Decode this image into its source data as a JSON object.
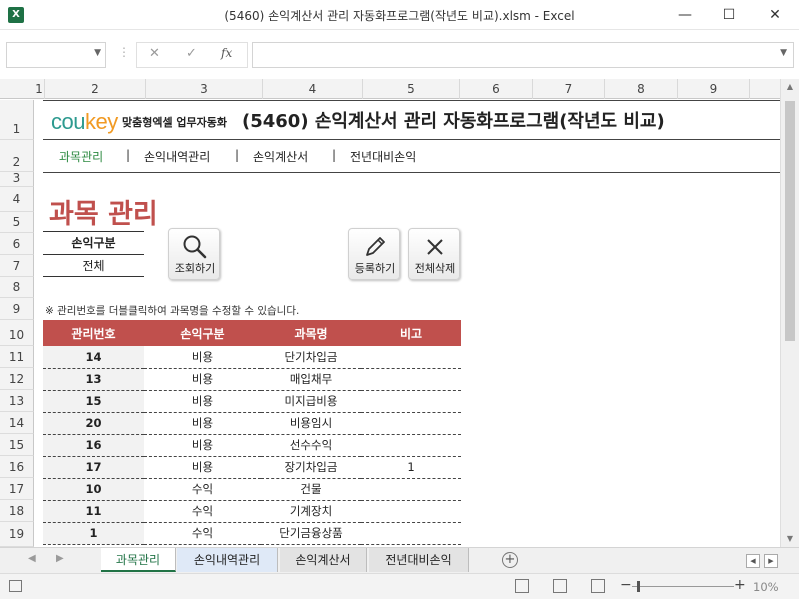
{
  "window": {
    "title": "(5460) 손익계산서 관리 자동화프로그램(작년도 비교).xlsm - Excel",
    "app_icon": "X",
    "minimize": "—",
    "maximize": "☐",
    "close": "✕"
  },
  "formula_bar": {
    "cancel": "✕",
    "enter": "✓",
    "fx": "fx",
    "sep": "⋮"
  },
  "columns": [
    "1",
    "2",
    "3",
    "4",
    "5",
    "6",
    "7",
    "8",
    "9"
  ],
  "rows": [
    "1",
    "2",
    "3",
    "4",
    "5",
    "6",
    "7",
    "8",
    "9",
    "10",
    "11",
    "12",
    "13",
    "14",
    "15",
    "16",
    "17",
    "18",
    "19"
  ],
  "header": {
    "logo_main": "cou",
    "logo_accent": "key",
    "logo_sub": "맞춤형엑셀 업무자동화",
    "title": "(5460) 손익계산서 관리 자동화프로그램(작년도 비교)"
  },
  "nav": {
    "items": [
      "과목관리",
      "손익내역관리",
      "손익계산서",
      "전년대비손익"
    ],
    "sep": "|"
  },
  "section_title": "과목 관리",
  "filter": {
    "label": "손익구분",
    "value": "전체"
  },
  "buttons": {
    "search": "조회하기",
    "register": "등록하기",
    "delete_all": "전체삭제"
  },
  "note": "※ 관리번호를 더블클릭하여 과목명을 수정할 수 있습니다.",
  "table": {
    "headers": [
      "관리번호",
      "손익구분",
      "과목명",
      "비고"
    ],
    "rows": [
      [
        "14",
        "비용",
        "단기차입금",
        ""
      ],
      [
        "13",
        "비용",
        "매입채무",
        ""
      ],
      [
        "15",
        "비용",
        "미지급비용",
        ""
      ],
      [
        "20",
        "비용",
        "비용임시",
        ""
      ],
      [
        "16",
        "비용",
        "선수수익",
        ""
      ],
      [
        "17",
        "비용",
        "장기차입금",
        "1"
      ],
      [
        "10",
        "수익",
        "건물",
        ""
      ],
      [
        "11",
        "수익",
        "기계장치",
        ""
      ],
      [
        "1",
        "수익",
        "단기금융상품",
        ""
      ]
    ]
  },
  "sheet_tabs": {
    "tabs": [
      "과목관리",
      "손익내역관리",
      "손익계산서",
      "전년대비손익"
    ],
    "active": 0,
    "add": "+"
  },
  "status": {
    "zoom": "10%",
    "zoom_minus": "−",
    "zoom_plus": "+"
  }
}
